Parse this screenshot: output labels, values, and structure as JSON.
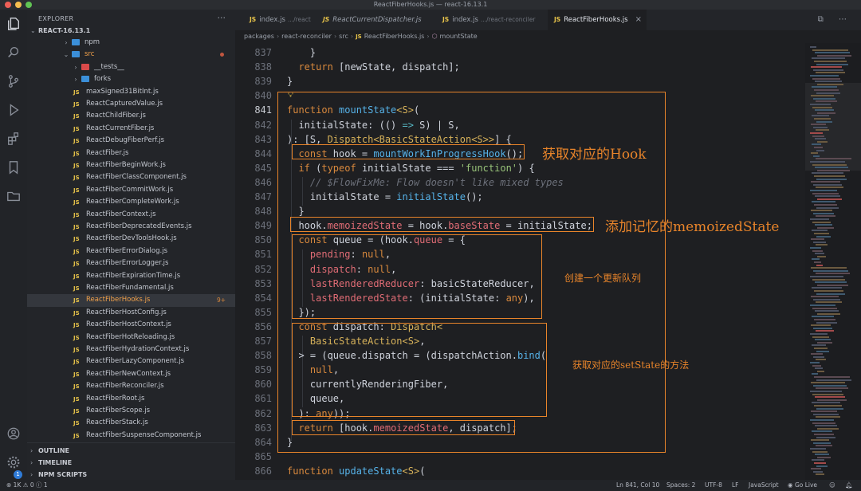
{
  "window": {
    "title": "ReactFiberHooks.js — react-16.13.1"
  },
  "explorer": {
    "header": "EXPLORER",
    "more": "···",
    "root": "REACT-16.13.1",
    "tree": [
      {
        "label": "npm",
        "kind": "folder",
        "depth": 3,
        "caret": "›",
        "color": "#3b8fd9"
      },
      {
        "label": "src",
        "kind": "folder",
        "depth": 3,
        "caret": "⌄",
        "color": "#3b8fd9",
        "dot": true,
        "labelColor": "#f0a04a"
      },
      {
        "label": "__tests__",
        "kind": "folder",
        "depth": 4,
        "caret": "›",
        "color": "#d94a4a"
      },
      {
        "label": "forks",
        "kind": "folder",
        "depth": 4,
        "caret": "›",
        "color": "#3b8fd9"
      },
      {
        "label": "maxSigned31BitInt.js",
        "kind": "js",
        "depth": 4
      },
      {
        "label": "ReactCapturedValue.js",
        "kind": "js",
        "depth": 4
      },
      {
        "label": "ReactChildFiber.js",
        "kind": "js",
        "depth": 4
      },
      {
        "label": "ReactCurrentFiber.js",
        "kind": "js",
        "depth": 4
      },
      {
        "label": "ReactDebugFiberPerf.js",
        "kind": "js",
        "depth": 4
      },
      {
        "label": "ReactFiber.js",
        "kind": "js",
        "depth": 4
      },
      {
        "label": "ReactFiberBeginWork.js",
        "kind": "js",
        "depth": 4
      },
      {
        "label": "ReactFiberClassComponent.js",
        "kind": "js",
        "depth": 4
      },
      {
        "label": "ReactFiberCommitWork.js",
        "kind": "js",
        "depth": 4
      },
      {
        "label": "ReactFiberCompleteWork.js",
        "kind": "js",
        "depth": 4
      },
      {
        "label": "ReactFiberContext.js",
        "kind": "js",
        "depth": 4
      },
      {
        "label": "ReactFiberDeprecatedEvents.js",
        "kind": "js",
        "depth": 4
      },
      {
        "label": "ReactFiberDevToolsHook.js",
        "kind": "js",
        "depth": 4
      },
      {
        "label": "ReactFiberErrorDialog.js",
        "kind": "js",
        "depth": 4
      },
      {
        "label": "ReactFiberErrorLogger.js",
        "kind": "js",
        "depth": 4
      },
      {
        "label": "ReactFiberExpirationTime.js",
        "kind": "js",
        "depth": 4
      },
      {
        "label": "ReactFiberFundamental.js",
        "kind": "js",
        "depth": 4
      },
      {
        "label": "ReactFiberHooks.js",
        "kind": "js",
        "depth": 4,
        "active": true,
        "count": "9+"
      },
      {
        "label": "ReactFiberHostConfig.js",
        "kind": "js",
        "depth": 4
      },
      {
        "label": "ReactFiberHostContext.js",
        "kind": "js",
        "depth": 4
      },
      {
        "label": "ReactFiberHotReloading.js",
        "kind": "js",
        "depth": 4
      },
      {
        "label": "ReactFiberHydrationContext.js",
        "kind": "js",
        "depth": 4
      },
      {
        "label": "ReactFiberLazyComponent.js",
        "kind": "js",
        "depth": 4
      },
      {
        "label": "ReactFiberNewContext.js",
        "kind": "js",
        "depth": 4
      },
      {
        "label": "ReactFiberReconciler.js",
        "kind": "js",
        "depth": 4
      },
      {
        "label": "ReactFiberRoot.js",
        "kind": "js",
        "depth": 4
      },
      {
        "label": "ReactFiberScope.js",
        "kind": "js",
        "depth": 4
      },
      {
        "label": "ReactFiberStack.js",
        "kind": "js",
        "depth": 4
      },
      {
        "label": "ReactFiberSuspenseComponent.js",
        "kind": "js",
        "depth": 4
      }
    ],
    "sections": {
      "outline": "OUTLINE",
      "timeline": "TIMELINE",
      "npm_scripts": "NPM SCRIPTS"
    }
  },
  "tabs": [
    {
      "label": "index.js",
      "hint": ".../react",
      "active": false
    },
    {
      "label": "ReactCurrentDispatcher.js",
      "hint": "",
      "active": false,
      "italic": true
    },
    {
      "label": "index.js",
      "hint": ".../react-reconciler",
      "active": false
    },
    {
      "label": "ReactFiberHooks.js",
      "hint": "",
      "active": true,
      "close": "×"
    }
  ],
  "tab_actions": "⧉ ⋯",
  "breadcrumb": {
    "items": [
      "packages",
      "react-reconciler",
      "src",
      "ReactFiberHooks.js",
      "mountState"
    ],
    "sep": "›",
    "js_tag": "JS"
  },
  "editor": {
    "current_line": 841,
    "lines": [
      {
        "n": 837,
        "tokens": [
          [
            "pl",
            "    }"
          ]
        ]
      },
      {
        "n": 838,
        "tokens": [
          [
            "pl",
            "  "
          ],
          [
            "kw",
            "return"
          ],
          [
            "pl",
            " [newState, dispatch];"
          ]
        ]
      },
      {
        "n": 839,
        "tokens": [
          [
            "pl",
            "}"
          ]
        ]
      },
      {
        "n": 840,
        "tokens": []
      },
      {
        "n": 841,
        "tokens": [
          [
            "kw",
            "function"
          ],
          [
            "pl",
            " "
          ],
          [
            "fn",
            "mountState"
          ],
          [
            "ty",
            "<S>"
          ],
          [
            "pl",
            "("
          ]
        ]
      },
      {
        "n": 842,
        "tokens": [
          [
            "pl",
            "  initialState: (() "
          ],
          [
            "op",
            "=>"
          ],
          [
            "pl",
            " S) | S,"
          ]
        ]
      },
      {
        "n": 843,
        "tokens": [
          [
            "pl",
            "): [S, "
          ],
          [
            "ty",
            "Dispatch<BasicStateAction<S>>"
          ],
          [
            "pl",
            "] {"
          ]
        ]
      },
      {
        "n": 844,
        "tokens": [
          [
            "pl",
            "  "
          ],
          [
            "kw",
            "const"
          ],
          [
            "pl",
            " hook = "
          ],
          [
            "fn",
            "mountWorkInProgressHook"
          ],
          [
            "pl",
            "();"
          ]
        ]
      },
      {
        "n": 845,
        "tokens": [
          [
            "pl",
            "  "
          ],
          [
            "kw",
            "if"
          ],
          [
            "pl",
            " ("
          ],
          [
            "kw",
            "typeof"
          ],
          [
            "pl",
            " initialState === "
          ],
          [
            "str",
            "'function'"
          ],
          [
            "pl",
            ") {"
          ]
        ]
      },
      {
        "n": 846,
        "tokens": [
          [
            "cm",
            "    // $FlowFixMe: Flow doesn't like mixed types"
          ]
        ]
      },
      {
        "n": 847,
        "tokens": [
          [
            "pl",
            "    initialState = "
          ],
          [
            "fn",
            "initialState"
          ],
          [
            "pl",
            "();"
          ]
        ]
      },
      {
        "n": 848,
        "tokens": [
          [
            "pl",
            "  }"
          ]
        ]
      },
      {
        "n": 849,
        "tokens": [
          [
            "pl",
            "  hook."
          ],
          [
            "pr",
            "memoizedState"
          ],
          [
            "pl",
            " = hook."
          ],
          [
            "pr",
            "baseState"
          ],
          [
            "pl",
            " = initialState;"
          ]
        ]
      },
      {
        "n": 850,
        "tokens": [
          [
            "pl",
            "  "
          ],
          [
            "kw",
            "const"
          ],
          [
            "pl",
            " queue = (hook."
          ],
          [
            "pr",
            "queue"
          ],
          [
            "pl",
            " = {"
          ]
        ]
      },
      {
        "n": 851,
        "tokens": [
          [
            "pl",
            "    "
          ],
          [
            "pr",
            "pending"
          ],
          [
            "pl",
            ": "
          ],
          [
            "kw",
            "null"
          ],
          [
            "pl",
            ","
          ]
        ]
      },
      {
        "n": 852,
        "tokens": [
          [
            "pl",
            "    "
          ],
          [
            "pr",
            "dispatch"
          ],
          [
            "pl",
            ": "
          ],
          [
            "kw",
            "null"
          ],
          [
            "pl",
            ","
          ]
        ]
      },
      {
        "n": 853,
        "tokens": [
          [
            "pl",
            "    "
          ],
          [
            "pr",
            "lastRenderedReducer"
          ],
          [
            "pl",
            ": basicStateReducer,"
          ]
        ]
      },
      {
        "n": 854,
        "tokens": [
          [
            "pl",
            "    "
          ],
          [
            "pr",
            "lastRenderedState"
          ],
          [
            "pl",
            ": (initialState: "
          ],
          [
            "kw",
            "any"
          ],
          [
            "pl",
            "),"
          ]
        ]
      },
      {
        "n": 855,
        "tokens": [
          [
            "pl",
            "  });"
          ]
        ]
      },
      {
        "n": 856,
        "tokens": [
          [
            "pl",
            "  "
          ],
          [
            "kw",
            "const"
          ],
          [
            "pl",
            " dispatch: "
          ],
          [
            "ty",
            "Dispatch<"
          ]
        ]
      },
      {
        "n": 857,
        "tokens": [
          [
            "pl",
            "    "
          ],
          [
            "ty",
            "BasicStateAction<S>"
          ],
          [
            "pl",
            ","
          ]
        ]
      },
      {
        "n": 858,
        "tokens": [
          [
            "pl",
            "  > = (queue.dispatch = (dispatchAction."
          ],
          [
            "fn",
            "bind"
          ],
          [
            "pl",
            "("
          ]
        ]
      },
      {
        "n": 859,
        "tokens": [
          [
            "pl",
            "    "
          ],
          [
            "kw",
            "null"
          ],
          [
            "pl",
            ","
          ]
        ]
      },
      {
        "n": 860,
        "tokens": [
          [
            "pl",
            "    currentlyRenderingFiber,"
          ]
        ]
      },
      {
        "n": 861,
        "tokens": [
          [
            "pl",
            "    queue,"
          ]
        ]
      },
      {
        "n": 862,
        "tokens": [
          [
            "pl",
            "  ): "
          ],
          [
            "kw",
            "any"
          ],
          [
            "pl",
            "));"
          ]
        ]
      },
      {
        "n": 863,
        "tokens": [
          [
            "pl",
            "  "
          ],
          [
            "kw",
            "return"
          ],
          [
            "pl",
            " [hook."
          ],
          [
            "pr",
            "memoizedState"
          ],
          [
            "pl",
            ", dispatch];"
          ]
        ]
      },
      {
        "n": 864,
        "tokens": [
          [
            "pl",
            "}"
          ]
        ]
      },
      {
        "n": 865,
        "tokens": []
      },
      {
        "n": 866,
        "tokens": [
          [
            "kw",
            "function"
          ],
          [
            "pl",
            " "
          ],
          [
            "fn",
            "updateState"
          ],
          [
            "ty",
            "<S>"
          ],
          [
            "pl",
            "("
          ]
        ]
      }
    ]
  },
  "annotations": {
    "hook": "获取对应的Hook",
    "memoized": "添加记忆的memoizedState",
    "queue": "创建一个更新队列",
    "setstate": "获取对应的setState的方法"
  },
  "colors": {
    "accent": "#e8842a",
    "keyword": "#d9893d",
    "function": "#56b2e8",
    "type": "#d7b25a",
    "string": "#98c379",
    "property": "#e06c75"
  },
  "statusbar": {
    "problems": "⊗ 1K ⚠ 0 ⓘ 1",
    "position": "Ln 841, Col 10",
    "spaces": "Spaces: 2",
    "encoding": "UTF-8",
    "eol": "LF",
    "language": "JavaScript",
    "golive": "Go Live",
    "settings_badge": "1"
  }
}
